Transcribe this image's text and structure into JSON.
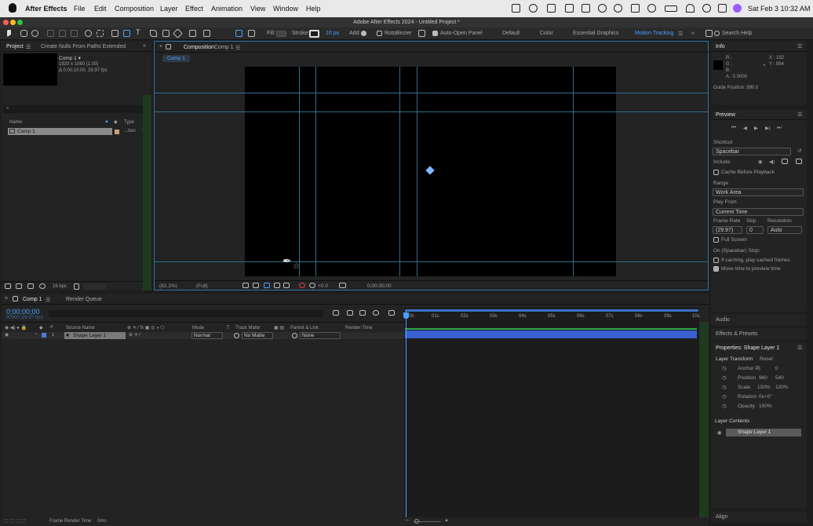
{
  "menubar": {
    "app": "After Effects",
    "items": [
      "File",
      "Edit",
      "Composition",
      "Layer",
      "Effect",
      "Animation",
      "View",
      "Window",
      "Help"
    ],
    "clock": "Sat Feb 3  10:32 AM"
  },
  "window": {
    "title": "Adobe After Effects 2024 - Untitled Project *"
  },
  "toolbar": {
    "fill": "Fill:",
    "stroke": "Stroke:",
    "stroke_px": "10 px",
    "add": "Add:",
    "rotobezier": "RotoBezier",
    "auto_open": "Auto-Open Panel",
    "workspaces": [
      "Default",
      "Color",
      "Essential Graphics",
      "Motion Tracking"
    ],
    "search": "Search Help"
  },
  "project": {
    "tab": "Project",
    "tab2": "Create Nulls From Paths Extended",
    "comp_name": "Comp 1 ▾",
    "comp_size": "1920 x 1080 (1.00)",
    "comp_dur": "Δ 0;00;10;00, 29.97 fps",
    "col_name": "Name",
    "col_type": "Type",
    "item_name": "Comp 1",
    "item_type": "...tion",
    "bpc": "16 bpc"
  },
  "comp": {
    "tab_prefix": "Composition",
    "tab_name": "Comp 1",
    "crumb": "Comp 1",
    "zoom": "(82.2%)",
    "res": "(Full)",
    "exposure": "+0.0",
    "timecode": "0;00;00;00"
  },
  "info": {
    "title": "Info",
    "r": "R :",
    "g": "G :",
    "b": "B :",
    "a": "A : 0.0000",
    "x": "X : 192",
    "y": "Y : 994",
    "guide": "Guide Position: 890.0"
  },
  "preview": {
    "title": "Preview",
    "shortcut_label": "Shortcut",
    "shortcut": "Spacebar",
    "include": "Include:",
    "cache": "Cache Before Playback",
    "range_label": "Range",
    "range": "Work Area",
    "playfrom_label": "Play From",
    "playfrom": "Current Time",
    "fr_label": "Frame Rate",
    "skip_label": "Skip",
    "res_label": "Resolution",
    "fr": "(29.97)",
    "skip": "0",
    "res": "Auto",
    "fullscreen": "Full Screen",
    "stop_label": "On (Spacebar) Stop:",
    "if_caching": "If caching, play cached frames",
    "move_time": "Move time to preview time"
  },
  "side": {
    "audio": "Audio",
    "effects": "Effects & Presets",
    "props_title": "Properties: Shape Layer 1",
    "layer_transform": "Layer Transform",
    "reset": "Reset",
    "anchor": "Anchor P..",
    "anchor_v": [
      "0",
      "0"
    ],
    "position": "Position",
    "position_v": [
      "960",
      "540"
    ],
    "scale": "Scale",
    "scale_v": [
      "100%",
      "100%"
    ],
    "rotation": "Rotation",
    "rotation_v": "0x+0°",
    "opacity": "Opacity",
    "opacity_v": "100%",
    "layer_contents": "Layer Contents",
    "content_item": "Shape Layer 1",
    "align": "Align"
  },
  "timeline": {
    "tab": "Comp 1",
    "render_queue": "Render Queue",
    "time": "0;00;00;00",
    "time_sub": "00000 (29.97 fps)",
    "col_source": "Source Name",
    "col_mode": "Mode",
    "col_t": "T",
    "col_track": "Track Matte",
    "col_parent": "Parent & Link",
    "col_render": "Render Time",
    "layer_index": "1",
    "layer_name": "Shape Layer 1",
    "layer_mode": "Normal",
    "layer_matte": "No Matte",
    "layer_parent": "None",
    "ruler": [
      "00s",
      "01s",
      "02s",
      "03s",
      "04s",
      "05s",
      "06s",
      "07s",
      "08s",
      "09s",
      "10s"
    ],
    "frame_render": "Frame Render Time",
    "frame_render_v": "0ms"
  }
}
